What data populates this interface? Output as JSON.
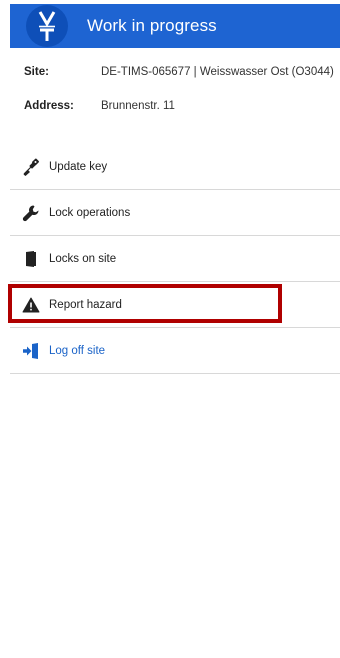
{
  "header": {
    "logo_text": "V T",
    "title": "Work in progress",
    "colors": {
      "background": "#1e64d2",
      "logo_circle": "#0e4fb8"
    }
  },
  "info": {
    "site_label": "Site:",
    "site_value": "DE-TIMS-065677 | Weisswasser Ost (O3044)",
    "address_label": "Address:",
    "address_value": "Brunnenstr. 11"
  },
  "menu": {
    "items": [
      {
        "label": "Update key",
        "icon": "key-icon"
      },
      {
        "label": "Lock operations",
        "icon": "wrench-icon"
      },
      {
        "label": "Locks on site",
        "icon": "door-icon"
      },
      {
        "label": "Report hazard",
        "icon": "warning-icon",
        "highlighted": true
      },
      {
        "label": "Log off site",
        "icon": "sign-out-icon",
        "accent": "#1a63c8"
      }
    ],
    "highlight_color": "#b00000"
  }
}
